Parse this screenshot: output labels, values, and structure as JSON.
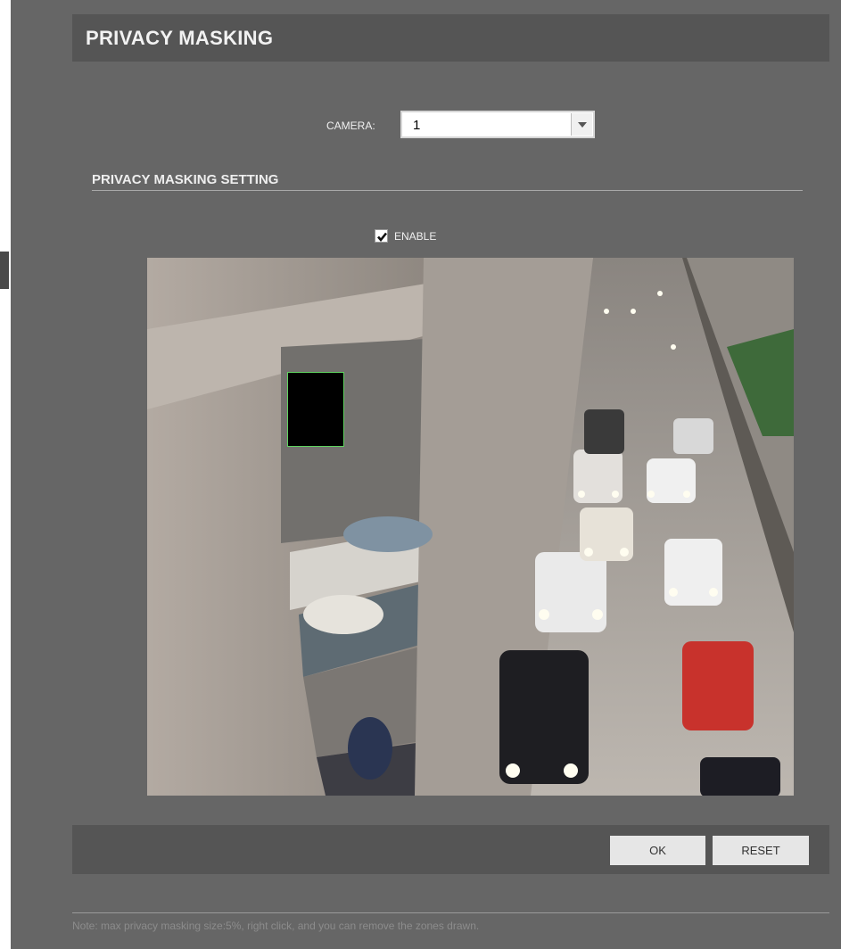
{
  "header": {
    "title": "PRIVACY MASKING"
  },
  "camera": {
    "label": "CAMERA:",
    "selected": "1"
  },
  "setting": {
    "section_title": "PRIVACY MASKING SETTING",
    "enable_label": "ENABLE",
    "enable_checked": true
  },
  "buttons": {
    "ok": "OK",
    "reset": "RESET"
  },
  "note": "Note: max privacy masking size:5%, right click, and you can remove the zones drawn.",
  "colors": {
    "background": "#666666",
    "bar": "#555555",
    "mask_border": "#5fd35f",
    "button": "#e6e6e6"
  },
  "icons": {
    "select_arrow": "chevron-down-icon",
    "checkbox": "checkmark-icon"
  }
}
